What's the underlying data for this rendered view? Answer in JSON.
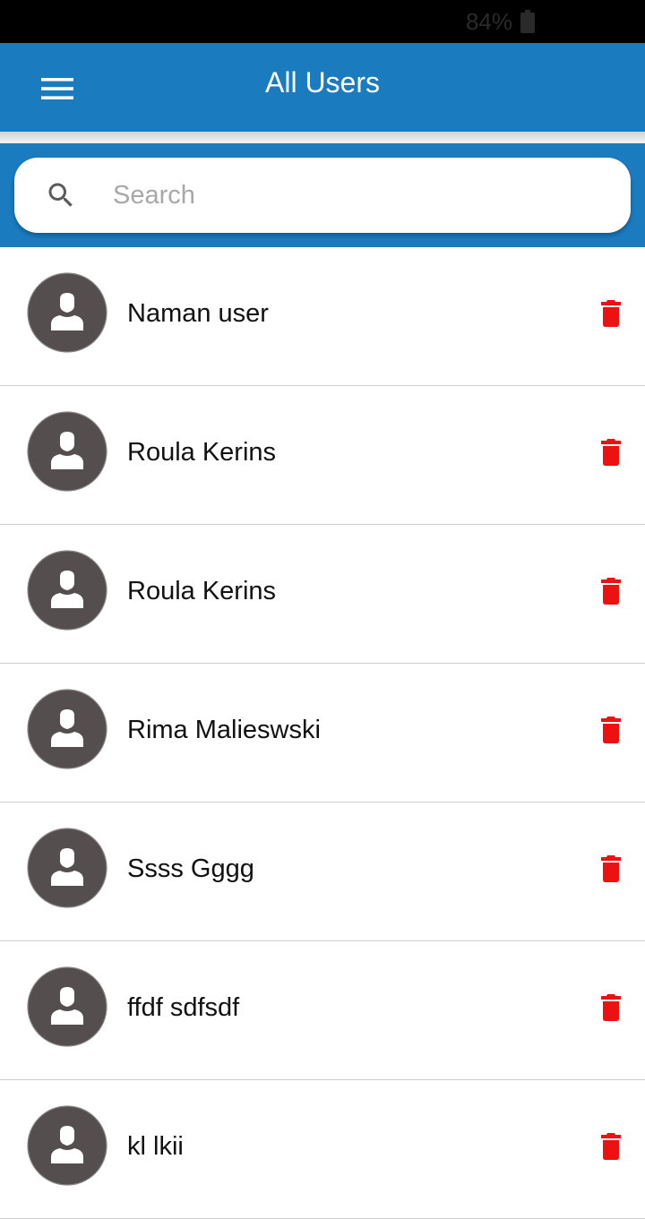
{
  "status_bar": {
    "battery_text": "84%",
    "battery_icon": "battery-icon"
  },
  "app_bar": {
    "title": "All Users",
    "menu_icon": "hamburger-menu-icon",
    "background": "#1a7bbf"
  },
  "search": {
    "placeholder": "Search",
    "value": "",
    "icon": "search-icon"
  },
  "users": [
    {
      "name": "Naman user"
    },
    {
      "name": "Roula Kerins"
    },
    {
      "name": "Roula Kerins"
    },
    {
      "name": "Rima Malieswski"
    },
    {
      "name": "Ssss Gggg"
    },
    {
      "name": "ffdf sdfsdf"
    },
    {
      "name": "kl lkii"
    }
  ],
  "icons": {
    "avatar": "user-avatar-icon",
    "delete": "trash-icon"
  },
  "colors": {
    "accent": "#1a7bbf",
    "delete": "#ee1111",
    "avatar_bg": "#544f4e"
  }
}
